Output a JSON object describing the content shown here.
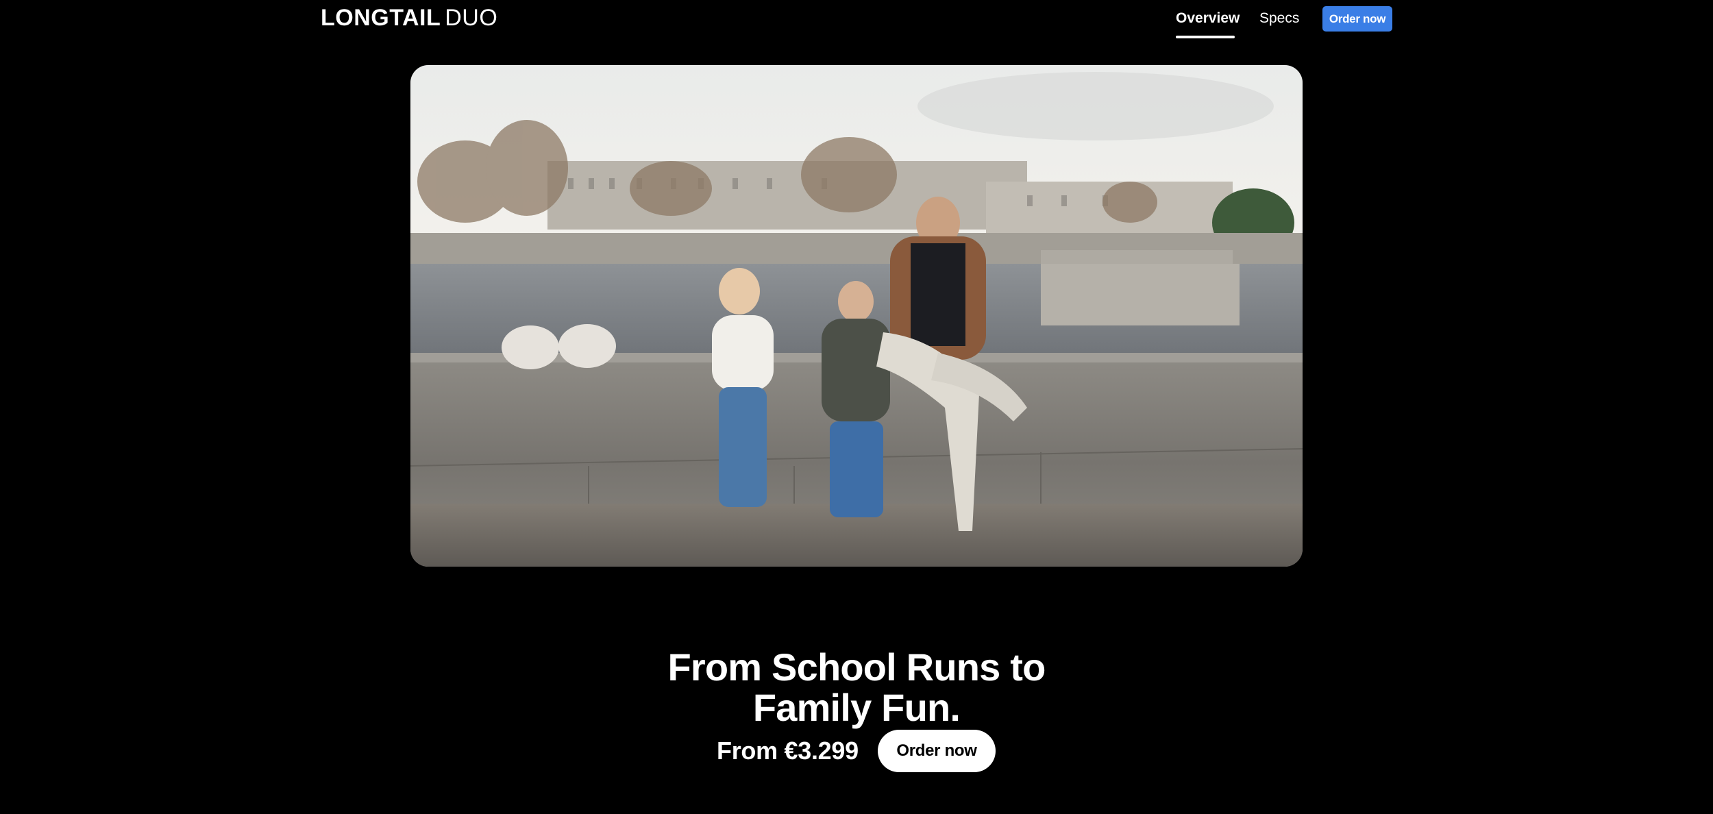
{
  "nav": {
    "logo_bold": "LONGTAIL",
    "logo_thin": "DUO",
    "links": [
      {
        "label": "Overview",
        "active": true
      },
      {
        "label": "Specs",
        "active": false
      }
    ],
    "order_button": "Order now"
  },
  "hero": {
    "image_description": "photo-of-family-sitting-on-riverside-wall"
  },
  "headline": {
    "line1": "From School Runs to",
    "line2": "Family Fun."
  },
  "price": "From €3.299",
  "cta": "Order now",
  "colors": {
    "background": "#000000",
    "text": "#ffffff",
    "accent": "#3a7ee6"
  }
}
